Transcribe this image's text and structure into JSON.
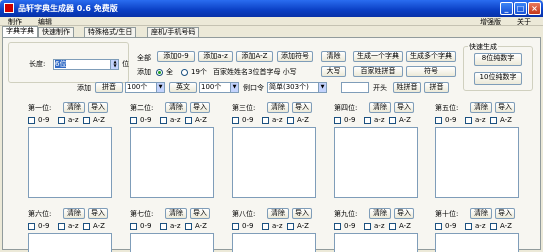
{
  "window": {
    "title": "品轩字典生成器 0.6 免费版"
  },
  "menu": {
    "items": [
      "制作",
      "编辑"
    ],
    "right": [
      "增强版",
      "关于"
    ]
  },
  "tabs": [
    "字典字典",
    "快速制作",
    "特殊格式/生日",
    "座机/手机号码"
  ],
  "form": {
    "length_label": "长度:",
    "length_value": "6位",
    "length_unit": "位",
    "all_label": "全部",
    "add_label": "添加",
    "radio_all": "全",
    "radio_19": "19个",
    "btn_add09": "添加0-9",
    "btn_addaz": "添加a-z",
    "btn_addAZ": "添加A-Z",
    "btn_addsym": "添加符号",
    "btn_clear": "清除",
    "btn_gen_one": "生成一个字典",
    "btn_gen_many": "生成多个字典",
    "hint_pinyin": "百家姓姓名3位首字母 小写",
    "btn_upper": "大写",
    "btn_surname": "百家姓拼音",
    "btn_symbol": "符号",
    "add2_label": "添加",
    "btn_pinyin": "拼音",
    "sel1": "100个",
    "btn_english": "英文",
    "sel2": "100个",
    "word_label": "例口令",
    "sel3": "简单(303个)",
    "btn_start": "开头",
    "btn_surname_pinyin": "姓拼音",
    "btn_pinyin2": "拼音"
  },
  "quick": {
    "title": "快速生成",
    "btn_8digit": "8位纯数字",
    "btn_10digit": "10位纯数字"
  },
  "positions": {
    "clear_label": "清除",
    "import_label": "导入",
    "chk_09": "0-9",
    "chk_az": "a-z",
    "chk_AZ": "A-Z",
    "row1": [
      "第一位:",
      "第二位:",
      "第三位:",
      "第四位:",
      "第五位:"
    ],
    "row2": [
      "第六位:",
      "第七位:",
      "第八位:",
      "第九位:",
      "第十位:"
    ]
  }
}
